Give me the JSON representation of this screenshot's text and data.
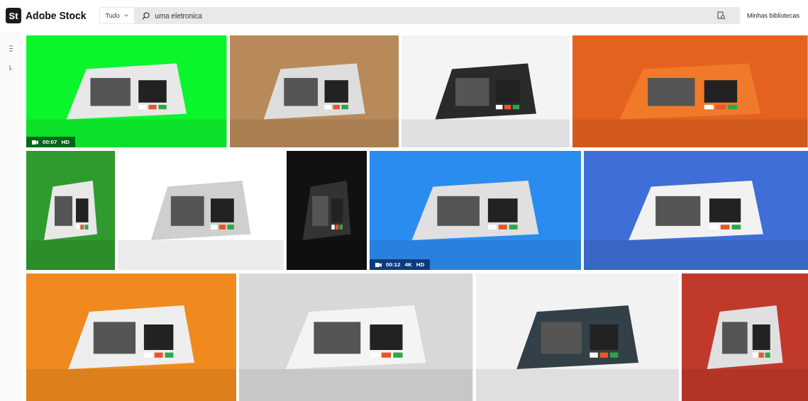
{
  "header": {
    "logo_mark": "St",
    "brand": "Adobe Stock",
    "filter": {
      "value": "Tudo"
    },
    "search": {
      "value": "urna eletronica"
    },
    "libraries_link": "Minhas bibliotecas"
  },
  "results": [
    {
      "tiles": [
        {
          "kind": "video",
          "duration": "00:07",
          "qualities": [
            "HD"
          ]
        },
        {
          "kind": "picture"
        },
        {
          "kind": "picture"
        },
        {
          "kind": "picture"
        }
      ]
    },
    {
      "tiles": [
        {
          "kind": "picture"
        },
        {
          "kind": "picture"
        },
        {
          "kind": "picture"
        },
        {
          "kind": "video",
          "duration": "00:12",
          "qualities": [
            "4K",
            "HD"
          ]
        },
        {
          "kind": "picture"
        }
      ]
    },
    {
      "tiles": [
        {
          "kind": "picture"
        },
        {
          "kind": "picture"
        },
        {
          "kind": "picture"
        },
        {
          "kind": "picture"
        }
      ]
    }
  ]
}
